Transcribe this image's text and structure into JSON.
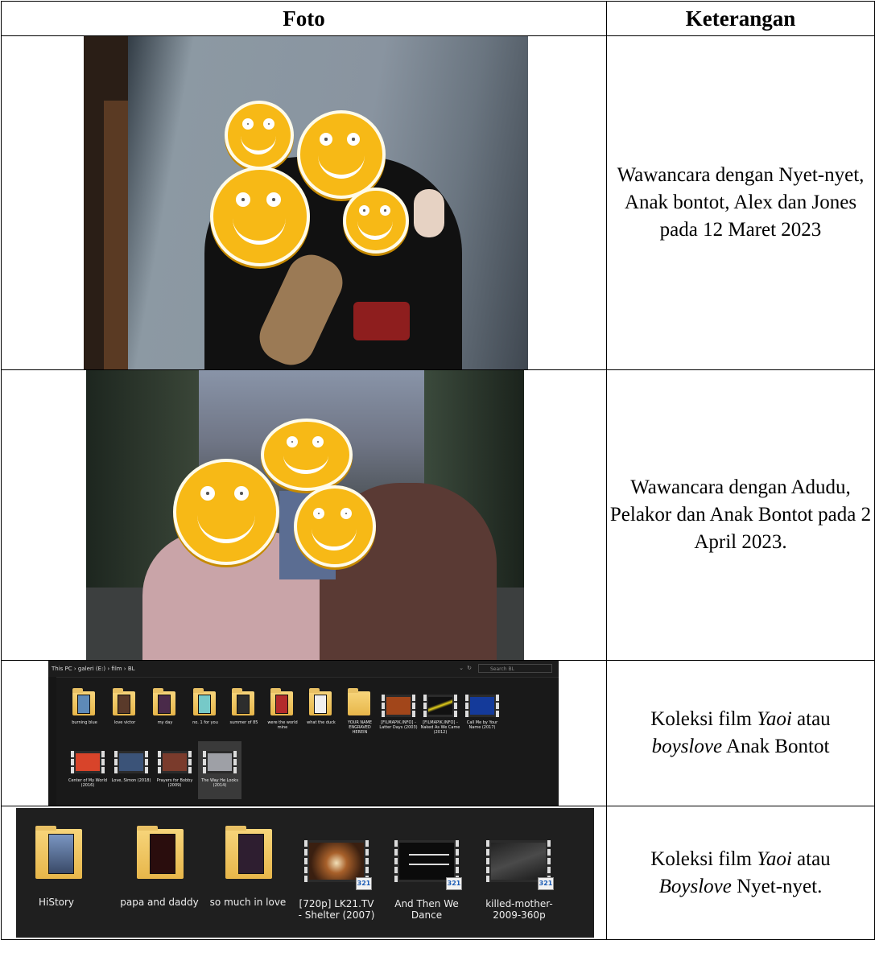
{
  "table": {
    "headers": {
      "photo": "Foto",
      "description": "Keterangan"
    },
    "rows": [
      {
        "description": "Wawancara dengan Nyet-nyet, Anak bontot, Alex dan Jones pada 12 Maret 2023"
      },
      {
        "description": "Wawancara dengan Adudu, Pelakor dan Anak Bontot pada 2 April 2023."
      },
      {
        "description_parts": [
          "Koleksi film ",
          "Yaoi",
          " atau ",
          "boyslove",
          " Anak Bontot"
        ]
      },
      {
        "description_parts": [
          "Koleksi film ",
          "Yaoi",
          " atau ",
          "Boyslove",
          " Nyet-nyet."
        ]
      }
    ]
  },
  "explorer1": {
    "breadcrumb": "This PC  ›  galeri (E:)  ›  film  ›  BL",
    "search_placeholder": "Search BL",
    "items": [
      "burning blue",
      "love victor",
      "my day",
      "no. 1 for you",
      "summer of 85",
      "were the world mine",
      "what the duck",
      "YOUR NAME ENGRAVED HEREIN",
      "[FILMAPIK.INFO] - Latter Days (2003)",
      "[FILMAPIK.INFO] - Naked As We Came (2012)",
      "Call Me by Your Name (2017)",
      "Center of My World (2016)",
      "Love, Simon (2018)",
      "Prayers for Bobby (2009)",
      "The Way He Looks (2014)"
    ]
  },
  "explorer2": {
    "items": [
      "HiStory",
      "papa and daddy",
      "so much in love",
      "[720p] LK21.TV - Shelter (2007)",
      "And Then We Dance",
      "killed-mother-2009-360p"
    ]
  }
}
